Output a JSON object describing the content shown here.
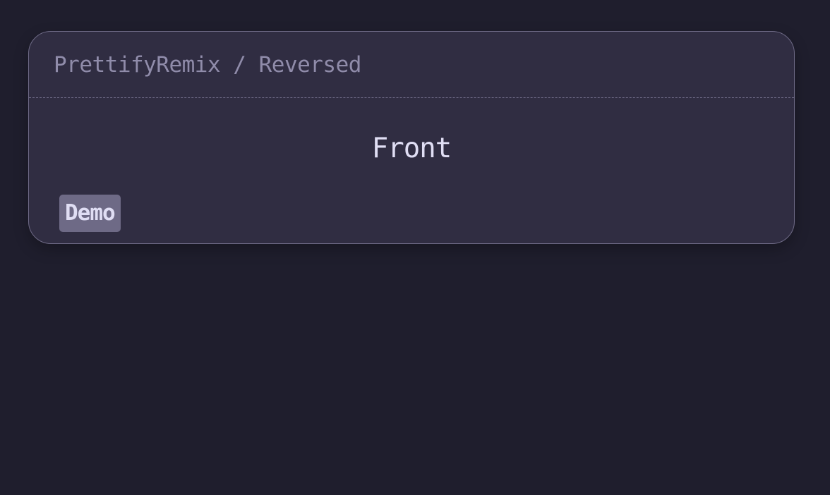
{
  "card": {
    "breadcrumb": "PrettifyRemix / Reversed",
    "content": "Front",
    "tag": "Demo"
  },
  "colors": {
    "background": "#1f1e2d",
    "card": "#302d42",
    "border": "#6e6a86",
    "muted_text": "#908caa",
    "text": "#e0def4",
    "tag_background": "#6e6a86"
  }
}
